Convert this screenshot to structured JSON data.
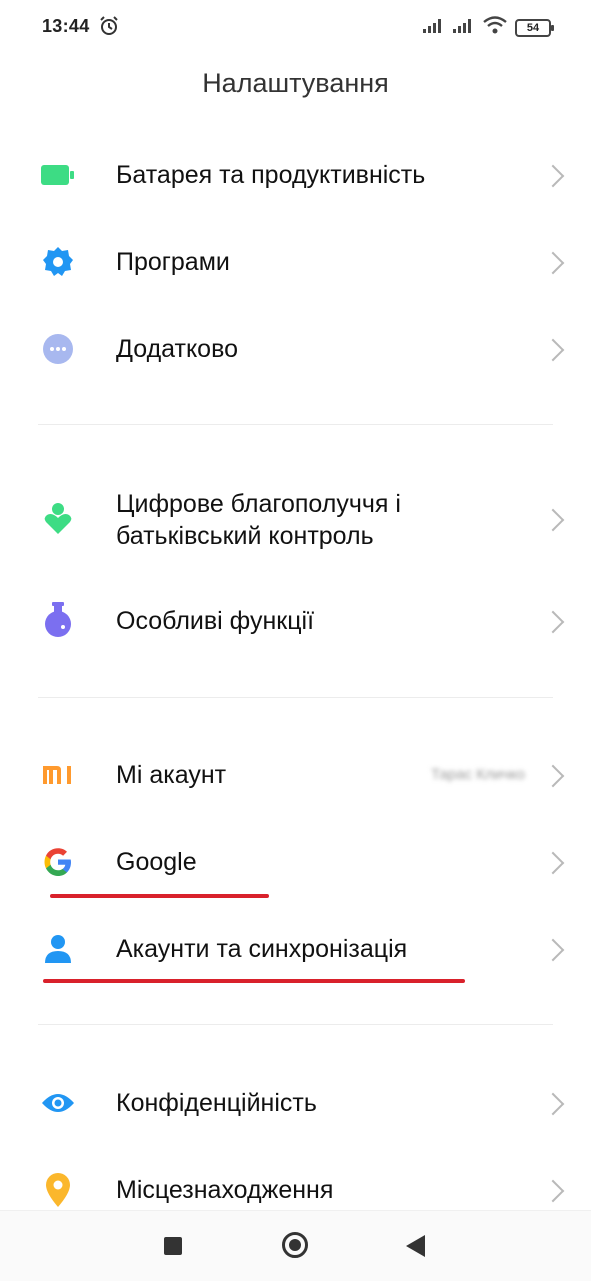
{
  "status_bar": {
    "time": "13:44",
    "battery": "54"
  },
  "header": {
    "title": "Налаштування"
  },
  "settings": {
    "battery": {
      "label": "Батарея та продуктивність",
      "icon": "battery-icon",
      "color": "#3ddc84"
    },
    "apps": {
      "label": "Програми",
      "icon": "gear-icon",
      "color": "#2196f3"
    },
    "additional": {
      "label": "Додатково",
      "icon": "more-dots-icon",
      "color": "#a8b8ef"
    },
    "wellbeing": {
      "label_line1": "Цифрове благополуччя і",
      "label_line2": "батьківський контроль",
      "icon": "wellbeing-icon",
      "color": "#3ddc84"
    },
    "special": {
      "label": "Особливі функції",
      "icon": "flask-icon",
      "color": "#7b6ff0"
    },
    "mi_account": {
      "label": "Мі акаунт",
      "value": "Тарас Кличко",
      "icon": "mi-logo-icon",
      "color": "#ff9a2e"
    },
    "google": {
      "label": "Google",
      "icon": "google-logo-icon"
    },
    "accounts": {
      "label": "Акаунти та синхронізація",
      "icon": "person-icon",
      "color": "#2196f3"
    },
    "privacy": {
      "label": "Конфіденційність",
      "icon": "eye-icon",
      "color": "#2196f3"
    },
    "location": {
      "label": "Місцезнаходження",
      "icon": "location-pin-icon",
      "color": "#fbb72c"
    }
  },
  "annotation": {
    "underline_color": "#d9212b"
  }
}
